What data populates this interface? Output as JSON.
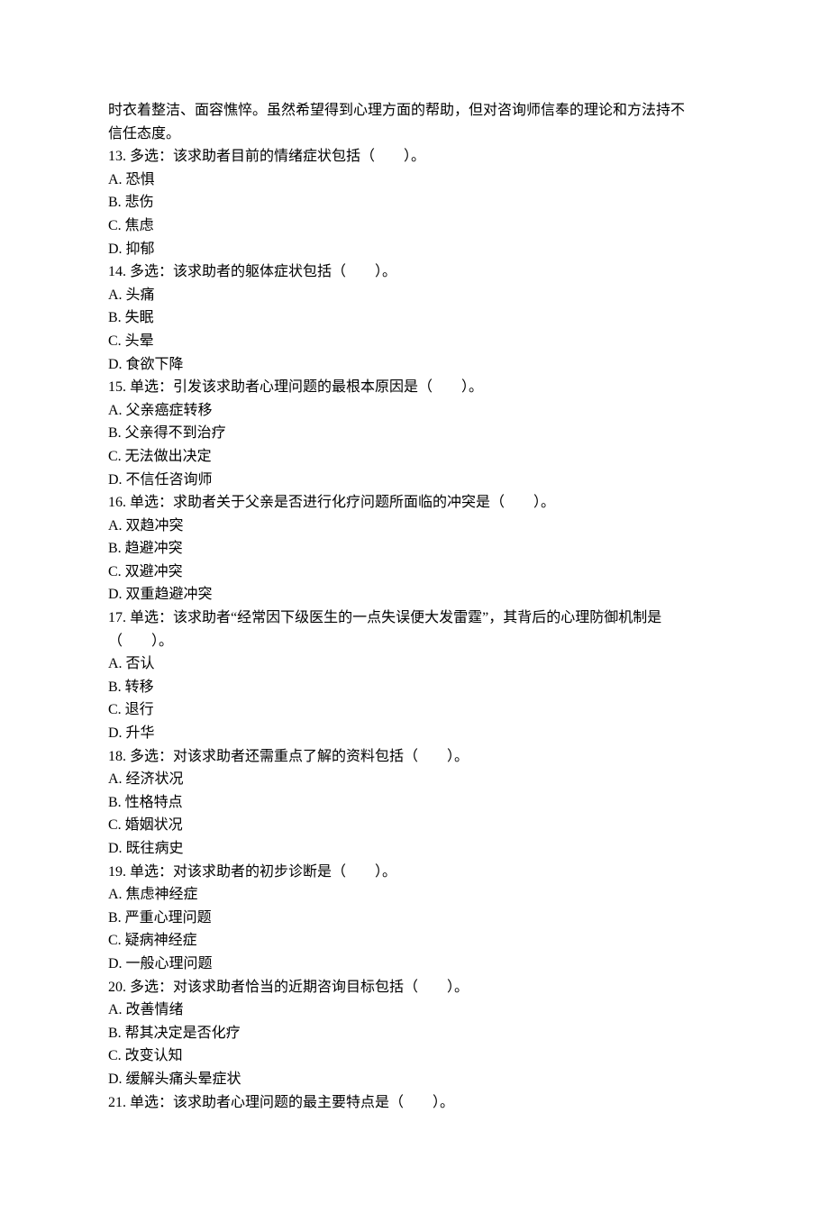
{
  "intro1": "时衣着整洁、面容憔悴。虽然希望得到心理方面的帮助，但对咨询师信奉的理论和方法持不",
  "intro2": "信任态度。",
  "questions": [
    {
      "stem": "13. 多选：该求助者目前的情绪症状包括（　　）。",
      "options": [
        "A. 恐惧",
        "B. 悲伤",
        "C. 焦虑",
        "D. 抑郁"
      ]
    },
    {
      "stem": "14. 多选：该求助者的躯体症状包括（　　）。",
      "options": [
        "A. 头痛",
        "B. 失眠",
        "C. 头晕",
        "D. 食欲下降"
      ]
    },
    {
      "stem": "15. 单选：引发该求助者心理问题的最根本原因是（　　）。",
      "options": [
        "A. 父亲癌症转移",
        "B. 父亲得不到治疗",
        "C. 无法做出决定",
        "D. 不信任咨询师"
      ]
    },
    {
      "stem": "16. 单选：求助者关于父亲是否进行化疗问题所面临的冲突是（　　）。",
      "options": [
        "A. 双趋冲突",
        "B. 趋避冲突",
        "C. 双避冲突",
        "D. 双重趋避冲突"
      ]
    },
    {
      "stem": "17. 单选：该求助者“经常因下级医生的一点失误便大发雷霆”，其背后的心理防御机制是（　　）。",
      "options": [
        "A. 否认",
        "B. 转移",
        "C. 退行",
        "D. 升华"
      ]
    },
    {
      "stem": "18. 多选：对该求助者还需重点了解的资料包括（　　）。",
      "options": [
        "A. 经济状况",
        "B. 性格特点",
        "C. 婚姻状况",
        "D. 既往病史"
      ]
    },
    {
      "stem": "19. 单选：对该求助者的初步诊断是（　　）。",
      "options": [
        "A. 焦虑神经症",
        "B. 严重心理问题",
        "C. 疑病神经症",
        "D. 一般心理问题"
      ]
    },
    {
      "stem": "20. 多选：对该求助者恰当的近期咨询目标包括（　　）。",
      "options": [
        "A. 改善情绪",
        "B. 帮其决定是否化疗",
        "C. 改变认知",
        "D. 缓解头痛头晕症状"
      ]
    },
    {
      "stem": "21. 单选：该求助者心理问题的最主要特点是（　　）。",
      "options": []
    }
  ]
}
